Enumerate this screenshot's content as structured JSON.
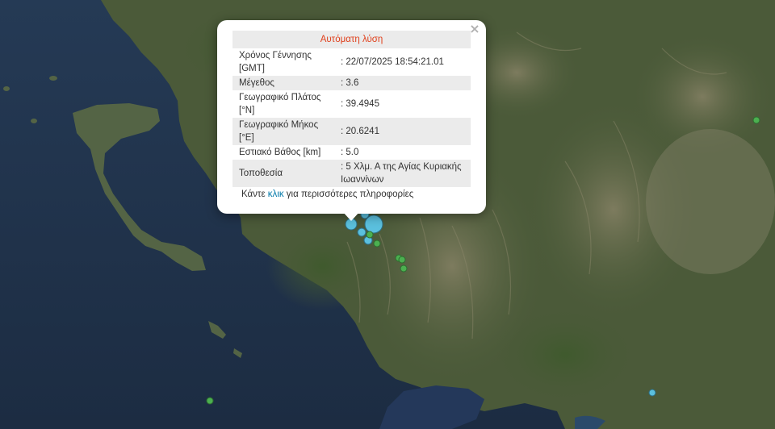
{
  "popup": {
    "title": "Αυτόματη λύση",
    "close_glyph": "×",
    "rows": [
      {
        "label": "Χρόνος Γέννησης [GMT]",
        "value": ": 22/07/2025 18:54:21.01"
      },
      {
        "label": "Μέγεθος",
        "value": ": 3.6"
      },
      {
        "label": "Γεωγραφικό Πλάτος [°N]",
        "value": ": 39.4945"
      },
      {
        "label": "Γεωγραφικό Μήκος [°E]",
        "value": ": 20.6241"
      },
      {
        "label": "Εστιακό Βάθος [km]",
        "value": ": 5.0"
      },
      {
        "label": "Τοποθεσία",
        "value": ": 5 Χλμ. Α της Αγίας Κυριακής Ιωαννίνων"
      }
    ],
    "more_prefix": "Κάντε ",
    "more_link": "κλικ",
    "more_suffix": " για περισσότερες πληροφορίες"
  },
  "map": {
    "type": "satellite",
    "colors": {
      "sea": "#1f3147",
      "land": "#4a5a38",
      "mountain": "#6b6a52",
      "quake_recent": "#5bc0de",
      "quake_older": "#4caf50"
    }
  }
}
